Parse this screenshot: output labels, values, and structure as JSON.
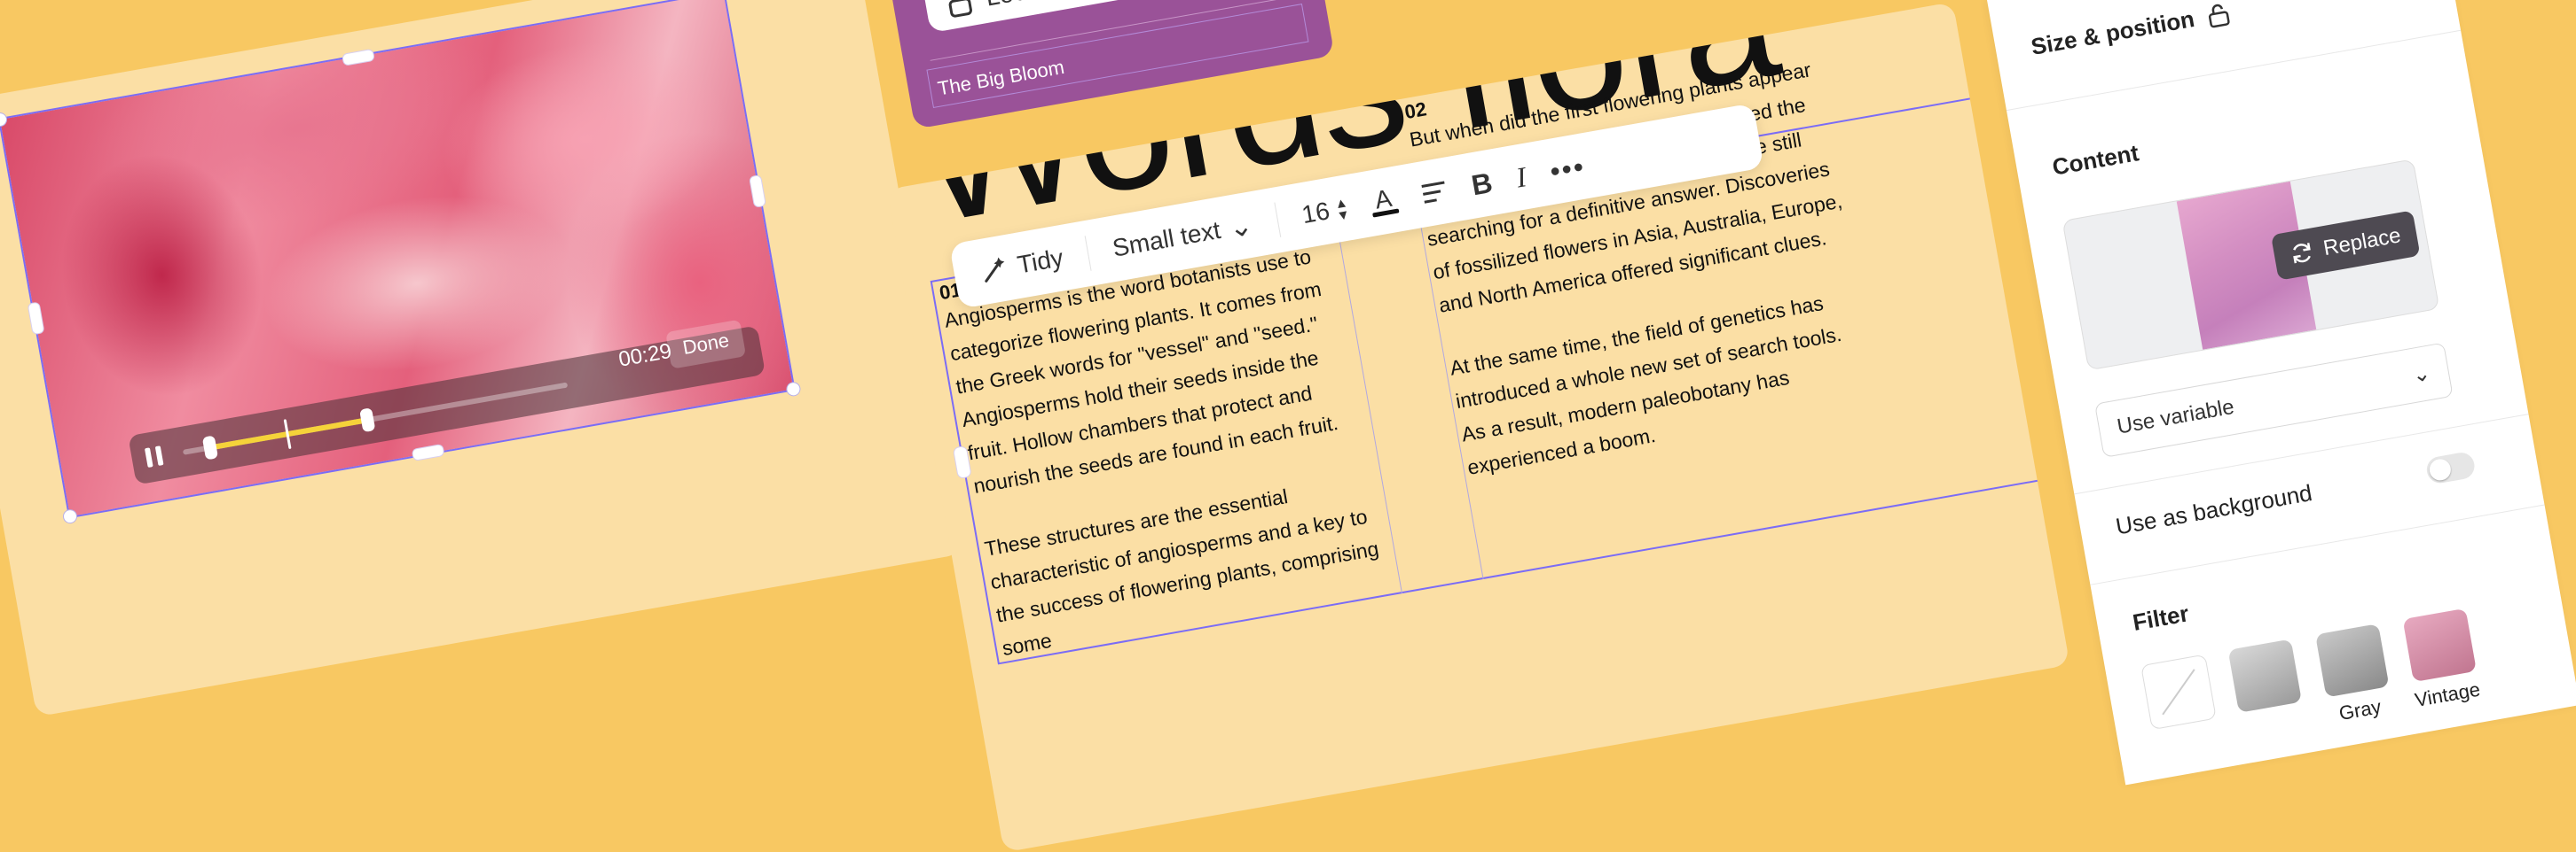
{
  "video": {
    "time": "00:29",
    "done_label": "Done",
    "progress": 0.48,
    "accent": "#f5d33a"
  },
  "purple_card": {
    "locked_label": "Locked",
    "layer_name": "The Big Bloom",
    "color": "#9a5298"
  },
  "text_card": {
    "headline": "Words flora",
    "column1": {
      "number": "01",
      "paragraphs": [
        "Angiosperms is the word botanists use to categorize flowering plants. It comes from the Greek words for \"vessel\" and \"seed.\" Angiosperms hold their seeds inside the fruit. Hollow chambers that protect and nourish the seeds are found in each fruit.",
        "These structures are the essential characteristic of angiosperms and a key to the success of flowering plants, comprising some"
      ]
    },
    "column2": {
      "number": "02",
      "paragraphs": [
        "But when did the first flowering plants appear and how? Charles Darwin contemplated the same question, and paleobotanists are still searching for a definitive answer. Discoveries of fossilized flowers in Asia, Australia, Europe, and North America offered significant clues.",
        "At the same time, the field of genetics has introduced a whole new set of search tools. As a result, modern paleobotany has experienced a boom."
      ]
    }
  },
  "toolbar": {
    "tidy_label": "Tidy",
    "style_label": "Small text",
    "font_size": "16",
    "icons": [
      "wand-icon",
      "chevron-down-icon",
      "stepper-icon",
      "text-color-icon",
      "align-icon",
      "bold-icon",
      "italic-icon",
      "more-icon"
    ]
  },
  "panel": {
    "size_position_label": "Size & position",
    "content_label": "Content",
    "replace_label": "Replace",
    "variable_label": "Use variable",
    "background_label": "Use as background",
    "background_on": false,
    "filter_label": "Filter",
    "filters": [
      {
        "label": "",
        "color": "#ffffff"
      },
      {
        "label": "",
        "color": "#b8b8b8"
      },
      {
        "label": "Gray",
        "color": "#a0a0a0"
      },
      {
        "label": "Vintage",
        "color": "#d38ea8"
      }
    ]
  }
}
